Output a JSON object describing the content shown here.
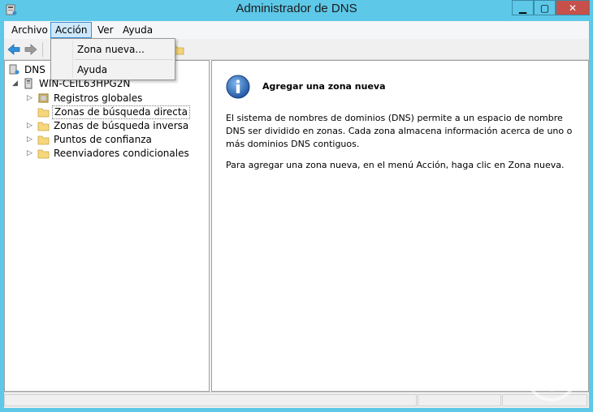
{
  "window": {
    "title": "Administrador de DNS",
    "controls": {
      "minimize": "▁",
      "maximize": "▢",
      "close": "✕"
    }
  },
  "menubar": {
    "items": [
      {
        "label": "Archivo"
      },
      {
        "label": "Acción",
        "active": true
      },
      {
        "label": "Ver"
      },
      {
        "label": "Ayuda"
      }
    ]
  },
  "dropdown": {
    "items": [
      {
        "label": "Zona nueva..."
      },
      {
        "label": "Ayuda"
      }
    ]
  },
  "tree": {
    "root": "DNS",
    "server": "WIN-CEIL63HPG2N",
    "children": [
      {
        "label": "Registros globales",
        "icon": "global-records-icon"
      },
      {
        "label": "Zonas de búsqueda directa",
        "icon": "folder-icon",
        "selected": true
      },
      {
        "label": "Zonas de búsqueda inversa",
        "icon": "folder-icon"
      },
      {
        "label": "Puntos de confianza",
        "icon": "folder-icon"
      },
      {
        "label": "Reenviadores condicionales",
        "icon": "folder-icon"
      }
    ]
  },
  "detail": {
    "title": "Agregar una zona nueva",
    "paragraphs": [
      "El sistema de nombres de dominios (DNS) permite a un espacio de nombre DNS ser dividido en zonas. Cada zona almacena información acerca de uno o más dominios DNS contiguos.",
      "Para agregar una zona nueva, en el menú Acción, haga clic en Zona nueva."
    ]
  },
  "colors": {
    "frame": "#5ec8e8",
    "close_button": "#c7504a",
    "menu_highlight": "#cde8fb"
  }
}
